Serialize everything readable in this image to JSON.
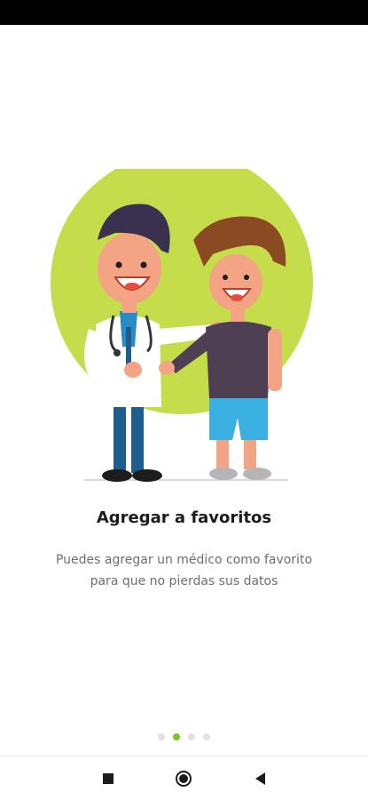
{
  "onboarding": {
    "title": "Agregar a favoritos",
    "subtitle_line1": "Puedes agregar un médico como favorito",
    "subtitle_line2": "para que no pierdas sus datos",
    "illustration": "doctor-and-patient-illustration",
    "page_count": 4,
    "active_page": 2
  },
  "colors": {
    "accent": "#7cc61f",
    "circle": "#c5dd4a",
    "dot_inactive": "#e2e2e2"
  },
  "nav": {
    "icons": [
      "recents-square-icon",
      "home-circle-icon",
      "back-triangle-icon"
    ]
  }
}
